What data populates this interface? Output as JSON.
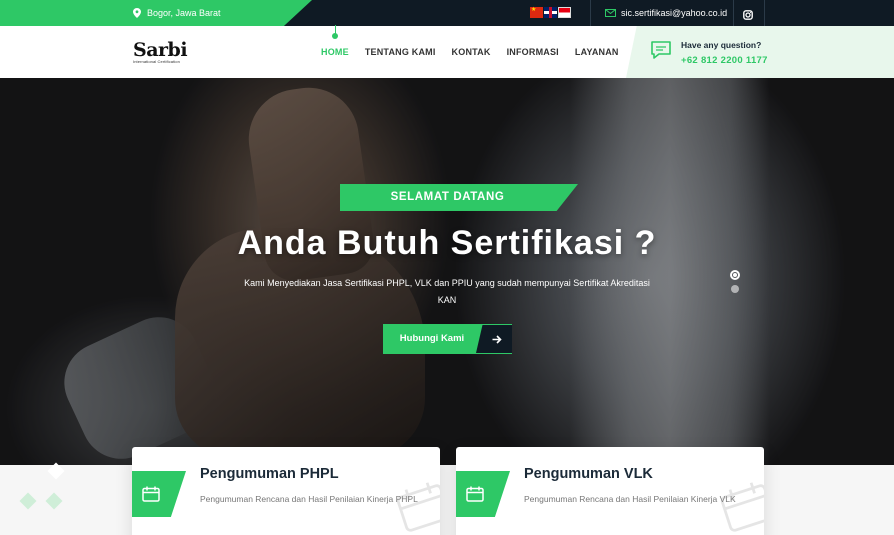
{
  "topbar": {
    "location": "Bogor, Jawa Barat",
    "email": "sic.sertifikasi@yahoo.co.id"
  },
  "header": {
    "logo_text": "Sarbi",
    "logo_subtitle": "International Certification",
    "nav": [
      "HOME",
      "TENTANG KAMI",
      "KONTAK",
      "INFORMASI",
      "LAYANAN"
    ],
    "question_label": "Have any question?",
    "phone": "+62 812 2200 1177"
  },
  "hero": {
    "tag": "SELAMAT DATANG",
    "title": "Anda Butuh Sertifikasi ?",
    "description": "Kami Menyediakan Jasa Sertifikasi PHPL, VLK dan PPIU yang sudah mempunyai Sertifikat Akreditasi KAN",
    "cta_label": "Hubungi Kami"
  },
  "cards": [
    {
      "title": "Pengumuman PHPL",
      "text": "Pengumuman Rencana dan Hasil Penilaian Kinerja PHPL"
    },
    {
      "title": "Pengumuman VLK",
      "text": "Pengumuman Rencana dan Hasil Penilaian Kinerja VLK"
    }
  ],
  "colors": {
    "accent": "#2ec866",
    "dark": "#0f1a24"
  }
}
